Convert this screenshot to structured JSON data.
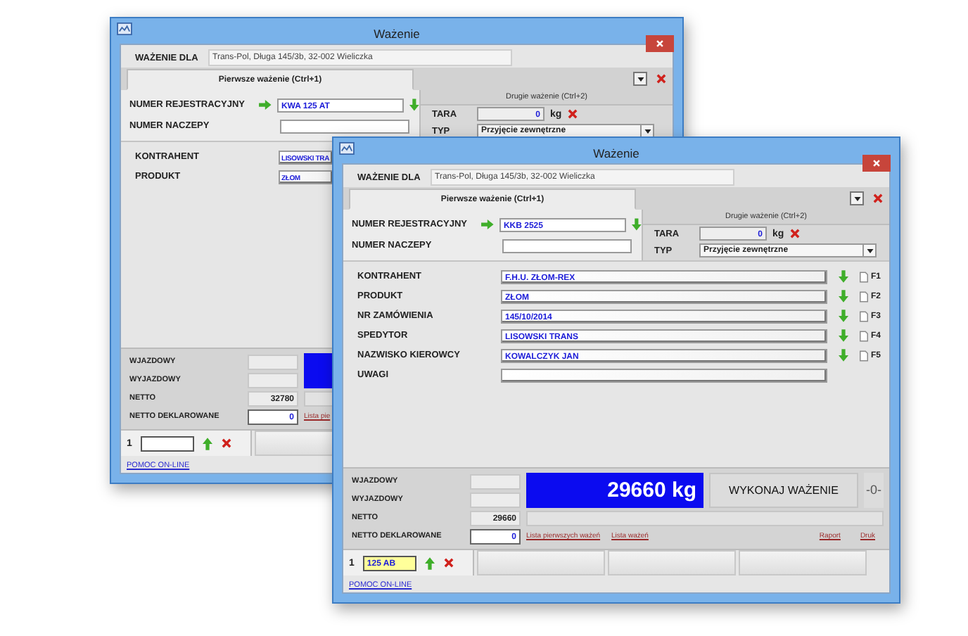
{
  "windows": [
    {
      "title": "Ważenie",
      "weighing_for": {
        "label": "WAŻENIE DLA",
        "value": "Trans-Pol, Długa 145/3b, 32-002 Wieliczka"
      },
      "tabs": [
        {
          "label": "Pierwsze ważenie (Ctrl+1)",
          "selected": true
        },
        {
          "label": "Drugie ważenie (Ctrl+2)",
          "selected": false
        }
      ],
      "registration": {
        "label": "NUMER REJESTRACYJNY",
        "value": "KWA 125 AT"
      },
      "trailer": {
        "label": "NUMER NACZEPY"
      },
      "tare": {
        "label": "TARA",
        "value": "0",
        "unit": "kg"
      },
      "type": {
        "label": "TYP",
        "value": "Przyjęcie zewnętrzne"
      },
      "fields": [
        {
          "label": "KONTRAHENT",
          "value": "LISOWSKI TRA"
        },
        {
          "label": "PRODUKT",
          "value": "ZŁOM"
        }
      ],
      "readings": [
        {
          "label": "WJAZDOWY",
          "kind": "readonly"
        },
        {
          "label": "WYJAZDOWY",
          "kind": "readonly"
        },
        {
          "label": "NETTO",
          "kind": "readonly",
          "value": "32780"
        },
        {
          "label": "NETTO DEKLAROWANE",
          "kind": "input",
          "value": "0"
        }
      ],
      "links_left": [
        "Lista pie"
      ],
      "queue": {
        "number": "1",
        "focused": false
      },
      "help_link": "POMOC ON-LINE"
    },
    {
      "title": "Ważenie",
      "weighing_for": {
        "label": "WAŻENIE DLA",
        "value": "Trans-Pol, Długa 145/3b, 32-002 Wieliczka"
      },
      "tabs": [
        {
          "label": "Pierwsze ważenie (Ctrl+1)",
          "selected": true
        },
        {
          "label": "Drugie ważenie (Ctrl+2)",
          "selected": false
        }
      ],
      "registration": {
        "label": "NUMER REJESTRACYJNY",
        "value": "KKB 2525"
      },
      "trailer": {
        "label": "NUMER NACZEPY"
      },
      "tare": {
        "label": "TARA",
        "value": "0",
        "unit": "kg"
      },
      "type": {
        "label": "TYP",
        "value": "Przyjęcie zewnętrzne"
      },
      "fields": [
        {
          "label": "KONTRAHENT",
          "value": "F.H.U. ZŁOM-REX",
          "key": "F1"
        },
        {
          "label": "PRODUKT",
          "value": "ZŁOM",
          "key": "F2"
        },
        {
          "label": "NR ZAMÓWIENIA",
          "value": "145/10/2014",
          "key": "F3"
        },
        {
          "label": "SPEDYTOR",
          "value": "LISOWSKI TRANS",
          "key": "F4"
        },
        {
          "label": "NAZWISKO KIEROWCY",
          "value": "KOWALCZYK JAN",
          "key": "F5"
        },
        {
          "label": "UWAGI"
        }
      ],
      "readings": [
        {
          "label": "WJAZDOWY",
          "kind": "readonly"
        },
        {
          "label": "WYJAZDOWY",
          "kind": "readonly"
        },
        {
          "label": "NETTO",
          "kind": "readonly",
          "value": "29660"
        },
        {
          "label": "NETTO DEKLAROWANE",
          "kind": "input",
          "value": "0"
        }
      ],
      "display": "29660 kg",
      "weigh_button": "WYKONAJ WAŻENIE",
      "counter": "-0-",
      "links_left": [
        "Lista pierwszych ważeń",
        "Lista ważeń"
      ],
      "links_right": [
        "Raport",
        "Druk"
      ],
      "queue": {
        "number": "1",
        "value": "125 AB",
        "focused": true
      },
      "help_link": "POMOC ON-LINE"
    }
  ]
}
